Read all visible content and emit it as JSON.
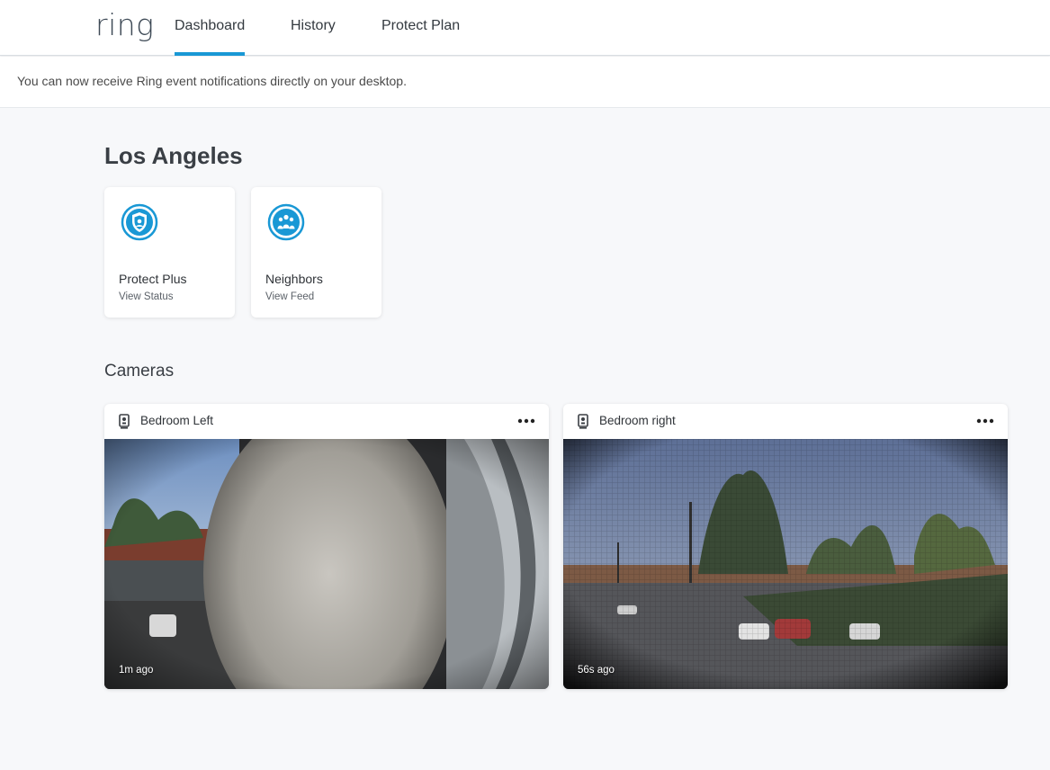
{
  "nav": {
    "logo": "ring",
    "tabs": [
      {
        "label": "Dashboard",
        "active": true
      },
      {
        "label": "History",
        "active": false
      },
      {
        "label": "Protect Plan",
        "active": false
      }
    ]
  },
  "banner": {
    "text": "You can now receive Ring event notifications directly on your desktop."
  },
  "location": {
    "title": "Los Angeles"
  },
  "features": [
    {
      "title": "Protect Plus",
      "subtitle": "View Status",
      "icon": "shield-icon"
    },
    {
      "title": "Neighbors",
      "subtitle": "View Feed",
      "icon": "neighbors-icon"
    }
  ],
  "cameras_section": {
    "title": "Cameras"
  },
  "cameras": [
    {
      "name": "Bedroom Left",
      "time": "1m ago",
      "icon": "camera-device-icon"
    },
    {
      "name": "Bedroom right",
      "time": "56s ago",
      "icon": "camera-device-icon"
    }
  ],
  "colors": {
    "accent": "#1998d5",
    "background": "#f7f8fa",
    "card": "#ffffff"
  }
}
